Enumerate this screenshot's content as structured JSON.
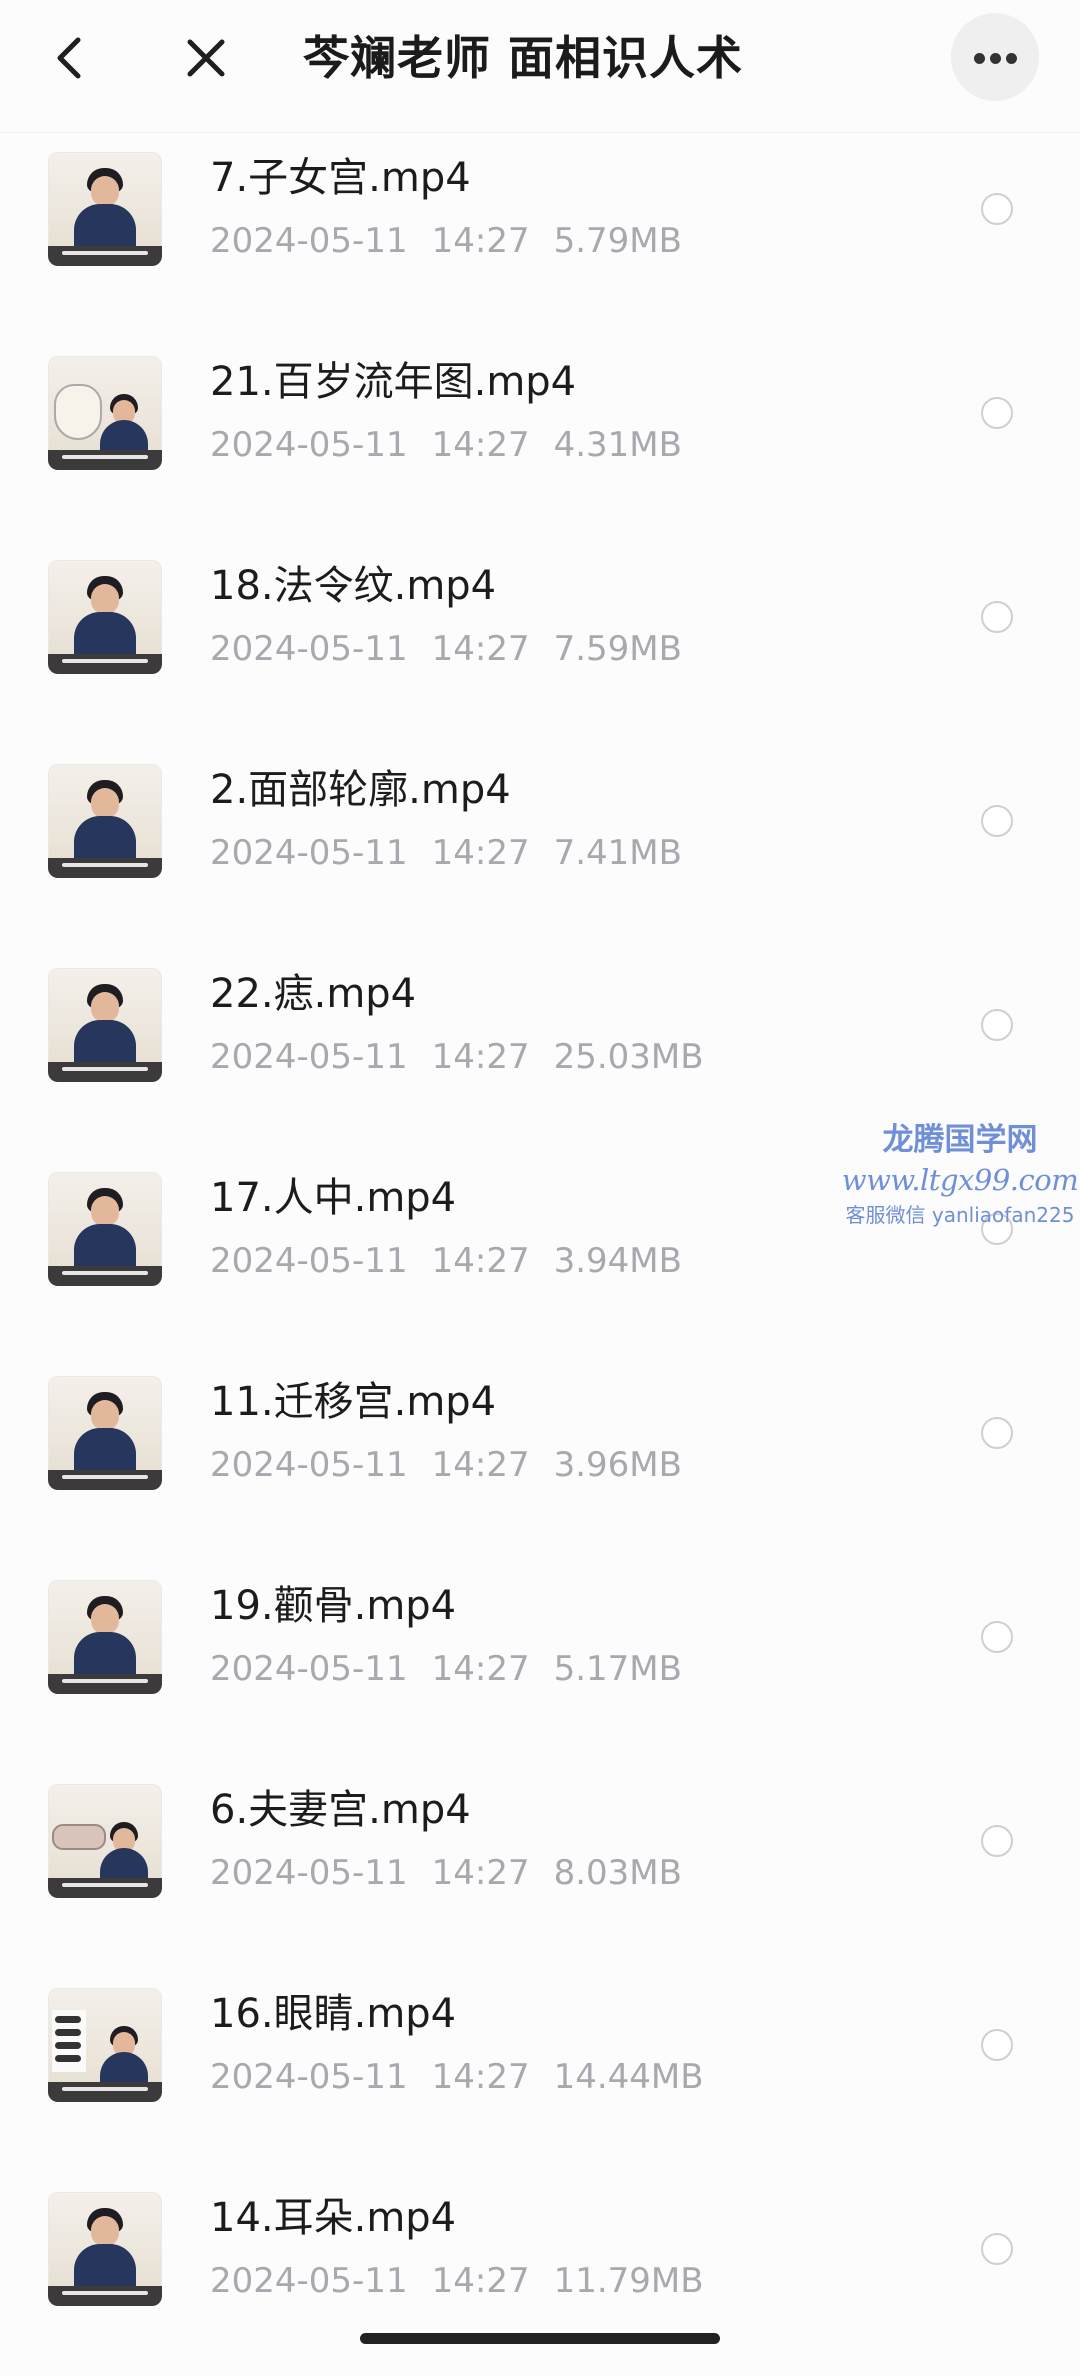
{
  "header": {
    "title": "芩斓老师 面相识人术",
    "back_icon": "chevron-left-icon",
    "close_icon": "close-icon",
    "more_icon": "more-horizontal-icon"
  },
  "files": [
    {
      "name": "7.子女宫.mp4",
      "date": "2024-05-11",
      "time": "14:27",
      "size": "5.79MB",
      "thumb": "presenter"
    },
    {
      "name": "21.百岁流年图.mp4",
      "date": "2024-05-11",
      "time": "14:27",
      "size": "4.31MB",
      "thumb": "face-chart"
    },
    {
      "name": "18.法令纹.mp4",
      "date": "2024-05-11",
      "time": "14:27",
      "size": "7.59MB",
      "thumb": "presenter"
    },
    {
      "name": "2.面部轮廓.mp4",
      "date": "2024-05-11",
      "time": "14:27",
      "size": "7.41MB",
      "thumb": "presenter"
    },
    {
      "name": "22.痣.mp4",
      "date": "2024-05-11",
      "time": "14:27",
      "size": "25.03MB",
      "thumb": "presenter"
    },
    {
      "name": "17.人中.mp4",
      "date": "2024-05-11",
      "time": "14:27",
      "size": "3.94MB",
      "thumb": "presenter"
    },
    {
      "name": "11.迁移宫.mp4",
      "date": "2024-05-11",
      "time": "14:27",
      "size": "3.96MB",
      "thumb": "presenter"
    },
    {
      "name": "19.颧骨.mp4",
      "date": "2024-05-11",
      "time": "14:27",
      "size": "5.17MB",
      "thumb": "presenter"
    },
    {
      "name": "6.夫妻宫.mp4",
      "date": "2024-05-11",
      "time": "14:27",
      "size": "8.03MB",
      "thumb": "eye-closeup"
    },
    {
      "name": "16.眼睛.mp4",
      "date": "2024-05-11",
      "time": "14:27",
      "size": "14.44MB",
      "thumb": "eye-list"
    },
    {
      "name": "14.耳朵.mp4",
      "date": "2024-05-11",
      "time": "14:27",
      "size": "11.79MB",
      "thumb": "presenter"
    }
  ],
  "watermark": {
    "line1": "龙腾国学网",
    "line2": "www.ltgx99.com",
    "line3": "客服微信 yanliaofan225"
  },
  "colors": {
    "background": "#fcfcfd",
    "meta_text": "#a7a9af",
    "watermark": "#6f8fd6"
  }
}
